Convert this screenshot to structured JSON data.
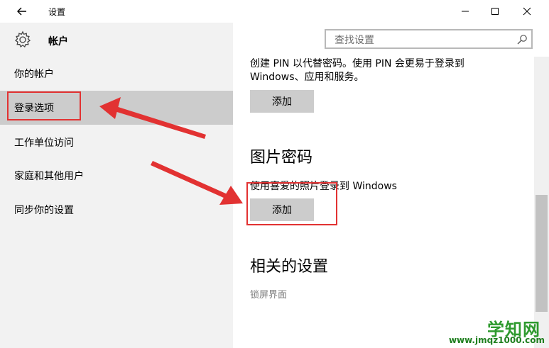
{
  "window": {
    "title": "设置",
    "minimize_icon": "minimize-icon",
    "maximize_icon": "maximize-icon",
    "close_icon": "close-icon"
  },
  "sidebar": {
    "section_title": "帐户",
    "items": [
      {
        "label": "你的帐户"
      },
      {
        "label": "登录选项",
        "selected": true
      },
      {
        "label": "工作单位访问"
      },
      {
        "label": "家庭和其他用户"
      },
      {
        "label": "同步你的设置"
      }
    ]
  },
  "search": {
    "placeholder": "查找设置"
  },
  "content": {
    "pin_description": "创建 PIN 以代替密码。使用 PIN 会更易于登录到 Windows、应用和服务。",
    "pin_add_label": "添加",
    "picture_password_title": "图片密码",
    "picture_password_description": "使用喜爱的照片登录到 Windows",
    "picture_add_label": "添加",
    "related_title": "相关的设置",
    "lock_screen_link": "锁屏界面"
  },
  "watermark": {
    "top": "学知网",
    "bottom": "www.jmqz1000.com"
  },
  "colors": {
    "annotation_red": "#e23232",
    "selected_bg": "#cccccc",
    "sidebar_bg": "#f2f2f2",
    "button_bg": "#cccccc",
    "watermark_green": "#2e9a2e"
  }
}
